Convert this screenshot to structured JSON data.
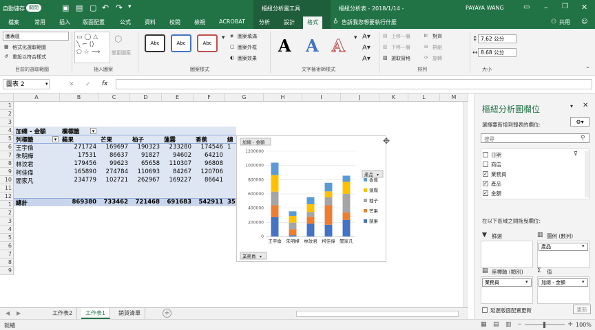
{
  "titlebar": {
    "autosave_label": "自動儲存",
    "autosave_state": "關閉",
    "context_tool": "樞紐分析圖工具",
    "doc_title": "樞紐分析表 - 2018/1/14 -",
    "user": "PAYAYA WANG"
  },
  "tabs": [
    "檔案",
    "常用",
    "插入",
    "版面配置",
    "公式",
    "資料",
    "校閱",
    "檢視",
    "ACROBAT",
    "分析",
    "設計",
    "格式"
  ],
  "tell_me": "告訴我您想要執行什麼",
  "share_label": "共用",
  "ribbon": {
    "chart_element_select": "圖表區",
    "format_selection": "格式化選取範圍",
    "reset_match_style": "重設以符合樣式",
    "group_current_selection": "目前的選取範圍",
    "change_shape": "變更圖案",
    "group_insert_shapes": "插入圖案",
    "shape_style_label": "Abc",
    "shape_fill": "圖案填滿",
    "shape_outline": "圖案外框",
    "shape_effects": "圖案效果",
    "group_shape_styles": "圖案樣式",
    "wordart_letter": "A",
    "group_wordart": "文字藝術師樣式",
    "bring_forward": "上移一層",
    "send_backward": "下移一層",
    "selection_pane": "選取窗格",
    "align": "對齊",
    "group": "群組",
    "rotate": "旋轉",
    "group_arrange": "排列",
    "height": "7.62 公分",
    "width": "8.68 公分",
    "group_size": "大小"
  },
  "formula_bar": {
    "name_box": "圖表 2",
    "fx": "fx",
    "cancel": "✕",
    "confirm": "✓"
  },
  "columns": [
    "A",
    "B",
    "C",
    "D",
    "E",
    "F",
    "G",
    "H",
    "I",
    "J",
    "K",
    "L",
    "M"
  ],
  "rows": [
    "1",
    "2",
    "3",
    "4",
    "5",
    "6",
    "7",
    "8",
    "9",
    "10",
    "11",
    "12",
    "1",
    "2",
    "3",
    "4",
    "5",
    "6",
    "7",
    "8",
    "9"
  ],
  "pivot": {
    "value_label": "加總 - 金額",
    "col_label": "欄標籤",
    "row_label": "列標籤",
    "headers": [
      "蘋果",
      "芒果",
      "柚子",
      "蓮霧",
      "香蕉",
      "總"
    ],
    "data": [
      {
        "name": "王宇倫",
        "values": [
          "271724",
          "169697",
          "190323",
          "233280",
          "174546",
          "1"
        ]
      },
      {
        "name": "朱明樺",
        "values": [
          "17531",
          "86637",
          "91827",
          "94602",
          "64210",
          ""
        ]
      },
      {
        "name": "林玟君",
        "values": [
          "179456",
          "99623",
          "65658",
          "110307",
          "96808",
          ""
        ]
      },
      {
        "name": "柯佳偉",
        "values": [
          "165890",
          "274784",
          "110693",
          "84267",
          "120706",
          ""
        ]
      },
      {
        "name": "閻家凡",
        "values": [
          "234779",
          "102721",
          "262967",
          "169227",
          "86641",
          ""
        ]
      }
    ],
    "total_label": "總計",
    "totals": [
      "869380",
      "733462",
      "721468",
      "691683",
      "542911",
      "35"
    ]
  },
  "chart_data": {
    "type": "bar",
    "stacked": true,
    "field_button_value": "加總 - 金額",
    "field_button_axis": "業務員",
    "legend_title": "產品",
    "legend_position": "right",
    "categories": [
      "王宇倫",
      "朱明樺",
      "林玟君",
      "柯佳偉",
      "閻家凡"
    ],
    "ylim": [
      0,
      1200000
    ],
    "yticks": [
      "0",
      "200000",
      "400000",
      "600000",
      "800000",
      "1000000",
      "1200000"
    ],
    "series": [
      {
        "name": "蘋果",
        "color": "#4472c4",
        "values": [
          271724,
          17531,
          179456,
          165890,
          234779
        ]
      },
      {
        "name": "芒果",
        "color": "#ed7d31",
        "values": [
          169697,
          86637,
          99623,
          274784,
          102721
        ]
      },
      {
        "name": "柚子",
        "color": "#a5a5a5",
        "values": [
          190323,
          91827,
          65658,
          110693,
          262967
        ]
      },
      {
        "name": "蓮霧",
        "color": "#ffc000",
        "values": [
          233280,
          94602,
          110307,
          84267,
          169227
        ]
      },
      {
        "name": "香蕉",
        "color": "#5b9bd5",
        "values": [
          174546,
          64210,
          96808,
          120706,
          86641
        ]
      }
    ]
  },
  "sheet_tabs": [
    "工作表2",
    "工作表1",
    "銷貨清單"
  ],
  "add_sheet": "+",
  "status": {
    "ready": "就緒",
    "zoom": "100%"
  },
  "pane": {
    "title": "樞紐分析圖欄位",
    "subtitle": "選擇要新增到報表的欄位:",
    "search_placeholder": "搜尋",
    "fields": [
      {
        "label": "日期",
        "checked": false
      },
      {
        "label": "商店",
        "checked": false
      },
      {
        "label": "業務員",
        "checked": true
      },
      {
        "label": "產品",
        "checked": true
      },
      {
        "label": "金額",
        "checked": true
      }
    ],
    "drag_hint": "在以下區域之間拖曳欄位:",
    "filters_label": "篩選",
    "legend_label": "圖例 (數列)",
    "legend_value": "產品",
    "axis_label": "座標軸 (類別)",
    "axis_value": "業務員",
    "values_label": "值",
    "values_value": "加總 - 金額",
    "defer_label": "延遲版面配置更新",
    "update_btn": "更新"
  }
}
